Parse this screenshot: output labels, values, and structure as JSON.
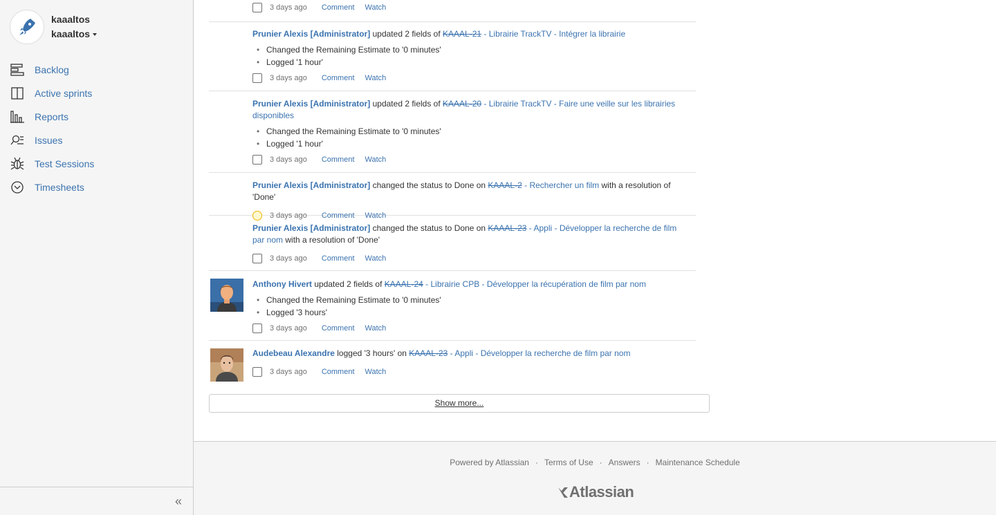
{
  "project": {
    "name": "kaaaltos",
    "board": "kaaaltos"
  },
  "nav": [
    {
      "label": "Backlog",
      "icon": "backlog-icon"
    },
    {
      "label": "Active sprints",
      "icon": "sprints-icon"
    },
    {
      "label": "Reports",
      "icon": "reports-icon"
    },
    {
      "label": "Issues",
      "icon": "issues-icon"
    },
    {
      "label": "Test Sessions",
      "icon": "bug-icon"
    },
    {
      "label": "Timesheets",
      "icon": "clock-icon"
    }
  ],
  "collapse_label": "«",
  "meta_labels": {
    "comment": "Comment",
    "watch": "Watch"
  },
  "activities": [
    {
      "time": "3 days ago"
    },
    {
      "user": "Prunier Alexis [Administrator]",
      "verb": "updated 2 fields of",
      "key": "KAAAL-21",
      "summary": "- Librairie TrackTV - Intégrer la librairie",
      "changes": [
        "Changed the Remaining Estimate to '0 minutes'",
        "Logged '1 hour'"
      ],
      "time": "3 days ago"
    },
    {
      "user": "Prunier Alexis [Administrator]",
      "verb": "updated 2 fields of",
      "key": "KAAAL-20",
      "summary": "- Librairie TrackTV - Faire une veille sur les librairies disponibles",
      "changes": [
        "Changed the Remaining Estimate to '0 minutes'",
        "Logged '1 hour'"
      ],
      "time": "3 days ago"
    },
    {
      "user": "Prunier Alexis [Administrator]",
      "verb": "changed the status to Done on",
      "key": "KAAAL-2",
      "summary": "- Rechercher un film",
      "suffix": "with a resolution of 'Done'",
      "time": "3 days ago"
    },
    {
      "user": "Prunier Alexis [Administrator]",
      "verb": "changed the status to Done on",
      "key": "KAAAL-23",
      "summary": "- Appli - Développer la recherche de film par nom",
      "suffix": "with a resolution of 'Done'",
      "time": "3 days ago"
    },
    {
      "user": "Anthony Hivert",
      "verb": "updated 2 fields of",
      "key": "KAAAL-24",
      "summary": "- Librairie CPB - Développer la récupération de film par nom",
      "changes": [
        "Changed the Remaining Estimate to '0 minutes'",
        "Logged '3 hours'"
      ],
      "time": "3 days ago"
    },
    {
      "user": "Audebeau Alexandre",
      "verb": "logged '3 hours' on",
      "key": "KAAAL-23",
      "summary": "- Appli - Développer la recherche de film par nom",
      "time": "3 days ago"
    }
  ],
  "show_more": "Show more...",
  "footer": {
    "links": [
      "Powered by Atlassian",
      "Terms of Use",
      "Answers",
      "Maintenance Schedule"
    ],
    "separator": "·",
    "logo": "Atlassian"
  }
}
